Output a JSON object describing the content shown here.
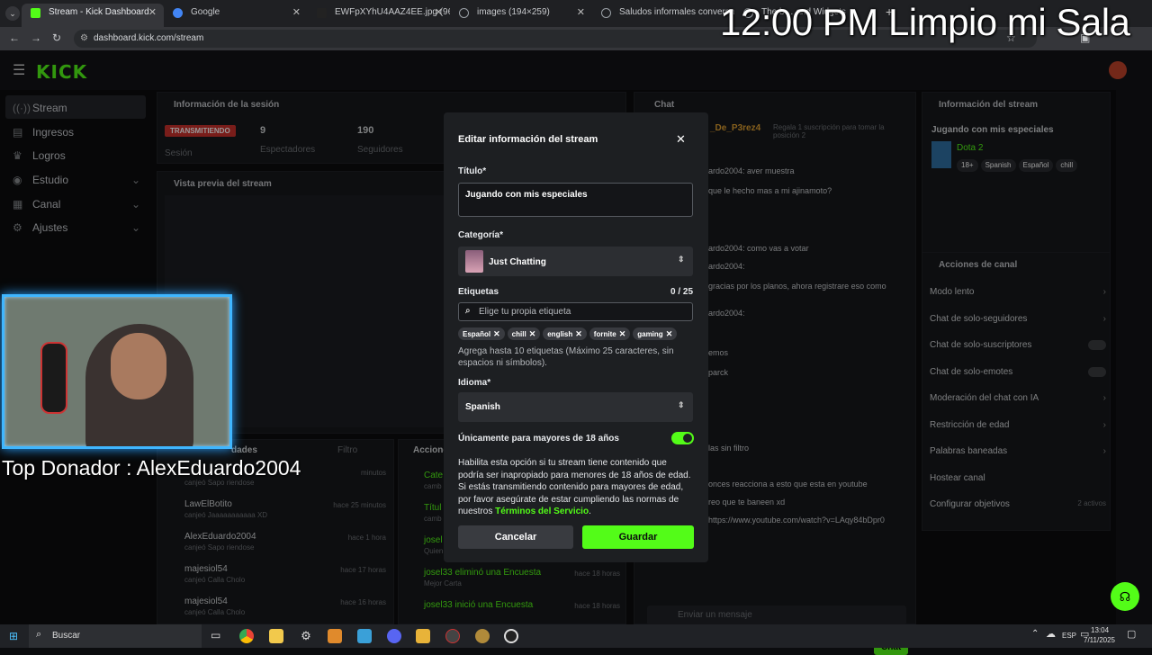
{
  "browser": {
    "tabs": [
      {
        "title": "Stream - Kick Dashboard",
        "color": "#53fc18"
      },
      {
        "title": "Google",
        "color": "#4285f4"
      },
      {
        "title": "EWFpXYhU4AAZ4EE.jpg (960×5",
        "color": "#1d9bf0"
      },
      {
        "title": "images (194×259)",
        "color": "#9aa0a6"
      },
      {
        "title": "Saludos informales conversacio",
        "color": "#9aa0a6"
      },
      {
        "title": "The b… and Widgets",
        "color": "#9aa0a6"
      }
    ],
    "url": "dashboard.kick.com/stream"
  },
  "overlay": {
    "clock_title": "12:00 PM Limpio mi Sala",
    "top_donor": "Top Donador : AlexEduardo2004"
  },
  "sidebar": {
    "items": [
      {
        "label": "Stream",
        "icon": "broadcast-icon"
      },
      {
        "label": "Ingresos",
        "icon": "wallet-icon"
      },
      {
        "label": "Logros",
        "icon": "trophy-icon"
      },
      {
        "label": "Estudio",
        "icon": "camera-icon"
      },
      {
        "label": "Canal",
        "icon": "channel-icon"
      },
      {
        "label": "Ajustes",
        "icon": "gear-icon"
      }
    ]
  },
  "session": {
    "title": "Información de la sesión",
    "status_badge": "TRANSMITIENDO",
    "status_sub": "Sesión",
    "viewers_value": "9",
    "viewers_label": "Espectadores",
    "followers_value": "190",
    "followers_label": "Seguidores",
    "preview_title": "Vista previa del stream"
  },
  "chat_panel": {
    "title": "Chat",
    "pinned_user": "_De_P3rez4",
    "pinned_text": "Regala 1 suscripción para tomar la posición 2",
    "messages": [
      "ardo2004: aver muestra",
      "que le hecho mas a mi ajinamoto?",
      "ardo2004: como vas a votar",
      "ardo2004:",
      "gracias por los planos, ahora registrare eso como",
      "ardo2004:",
      "emos",
      "parck",
      "las sin filtro",
      "onces reacciona a esto que esta en youtube",
      "reo que te baneen xd",
      "https://www.youtube.com/watch?v=LAqy84bDpr0"
    ],
    "input_placeholder": "Enviar un mensaje",
    "send_label": "Chat"
  },
  "stream_info": {
    "title": "Información del stream",
    "stream_title": "Jugando con mis especiales",
    "category": "Dota 2",
    "tags": [
      "18+",
      "Spanish",
      "Español",
      "chill"
    ]
  },
  "channel_actions": {
    "title": "Acciones de canal",
    "items": [
      "Modo lento",
      "Chat de solo-seguidores",
      "Chat de solo-suscriptores",
      "Chat de solo-emotes",
      "Moderación del chat con IA",
      "Restricción de edad",
      "Palabras baneadas",
      "Hostear canal",
      "Configurar objetivos"
    ],
    "goals_badge": "2 activos"
  },
  "activity": {
    "header_left": "dades",
    "filter_label": "Filtro",
    "rows": [
      {
        "user": "",
        "action": "canjeó Sapo riendose",
        "time": "minutos"
      },
      {
        "user": "LawElBotito",
        "action": "canjeó Jaaaaaaaaaaa XD",
        "time": "hace 25 minutos"
      },
      {
        "user": "AlexEduardo2004",
        "action": "canjeó Sapo riendose",
        "time": "hace 1 hora"
      },
      {
        "user": "majesiol54",
        "action": "canjeó Calla Cholo",
        "time": "hace 17 horas"
      },
      {
        "user": "majesiol54",
        "action": "canjeó Calla Cholo",
        "time": "hace 16 horas"
      }
    ]
  },
  "actions_panel": {
    "title": "Accione",
    "rows": [
      {
        "title": "Cate",
        "sub": "camb",
        "time": ""
      },
      {
        "title": "Títul",
        "sub": "camb",
        "time": ""
      },
      {
        "title": "josel",
        "sub": "Quien",
        "time": ""
      },
      {
        "title": "josel33 eliminó una Encuesta",
        "sub": "Mejor Carta",
        "time": "hace 18 horas"
      },
      {
        "title": "josel33 inició una Encuesta",
        "sub": "",
        "time": "hace 18 horas"
      }
    ]
  },
  "modal": {
    "title": "Editar información del stream",
    "title_label": "Título*",
    "title_value": "Jugando con mis especiales",
    "category_label": "Categoría*",
    "category_value": "Just Chatting",
    "tags_label": "Etiquetas",
    "tags_count": "0 / 25",
    "tags_placeholder": "Elige tu propia etiqueta",
    "tags": [
      "Español",
      "chill",
      "english",
      "fornite",
      "gaming"
    ],
    "tags_help": "Agrega hasta 10 etiquetas (Máximo 25 caracteres, sin espacios ni símbolos).",
    "language_label": "Idioma*",
    "language_value": "Spanish",
    "mature_label": "Únicamente para mayores de 18 años",
    "mature_enabled": true,
    "mature_help": "Habilita esta opción si tu stream tiene contenido que podría ser inapropiado para menores de 18 años de edad. Si estás transmitiendo contenido para mayores de edad, por favor asegúrate de estar cumpliendo las normas de nuestros",
    "terms_link": "Términos del Servicio",
    "terms_end": ".",
    "cancel_label": "Cancelar",
    "save_label": "Guardar"
  },
  "taskbar": {
    "search_label": "Buscar",
    "lang": "ESP",
    "time": "13:04",
    "date": "7/11/2025"
  }
}
